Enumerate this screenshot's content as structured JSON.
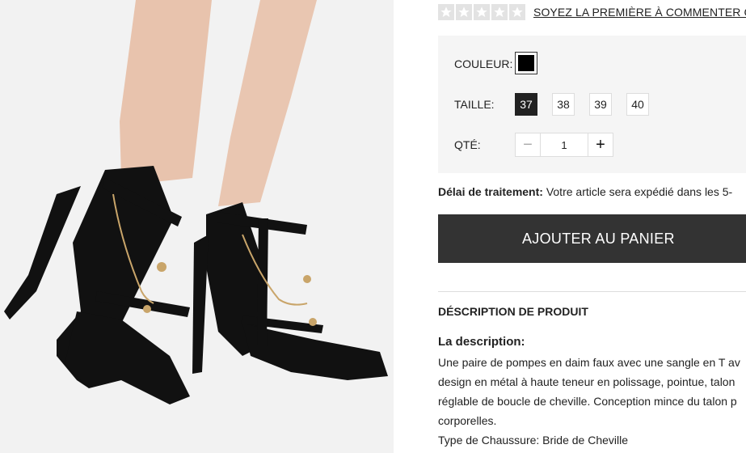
{
  "rating": {
    "stars_total": 5,
    "stars_filled": 0,
    "review_link": "SOYEZ LA PREMIÈRE À COMMENTER CET"
  },
  "options": {
    "color_label": "COULEUR:",
    "color_value": "#000000",
    "size_label": "TAILLE:",
    "sizes": [
      "37",
      "38",
      "39",
      "40"
    ],
    "selected_size": "37",
    "qty_label": "QTÉ:",
    "qty_value": "1",
    "qty_minus": "−",
    "qty_plus": "+"
  },
  "shipping": {
    "label": "Délai de traitement:",
    "text": " Votre article sera expédié dans les 5-"
  },
  "cart": {
    "button_label": "AJOUTER AU PANIER"
  },
  "description": {
    "section_title": "DÉSCRIPTION DE PRODUIT",
    "subtitle": "La description:",
    "lines": [
      "Une paire de pompes en daim faux avec une sangle en T av",
      "design en métal à haute teneur en polissage, pointue, talon",
      "réglable de boucle de cheville. Conception mince du talon p",
      "corporelles.",
      "Type de Chaussure: Bride de Cheville"
    ]
  },
  "colors": {
    "button_bg": "#333333",
    "options_bg": "#f5f5f5",
    "star_bg": "#e3e3e3"
  }
}
